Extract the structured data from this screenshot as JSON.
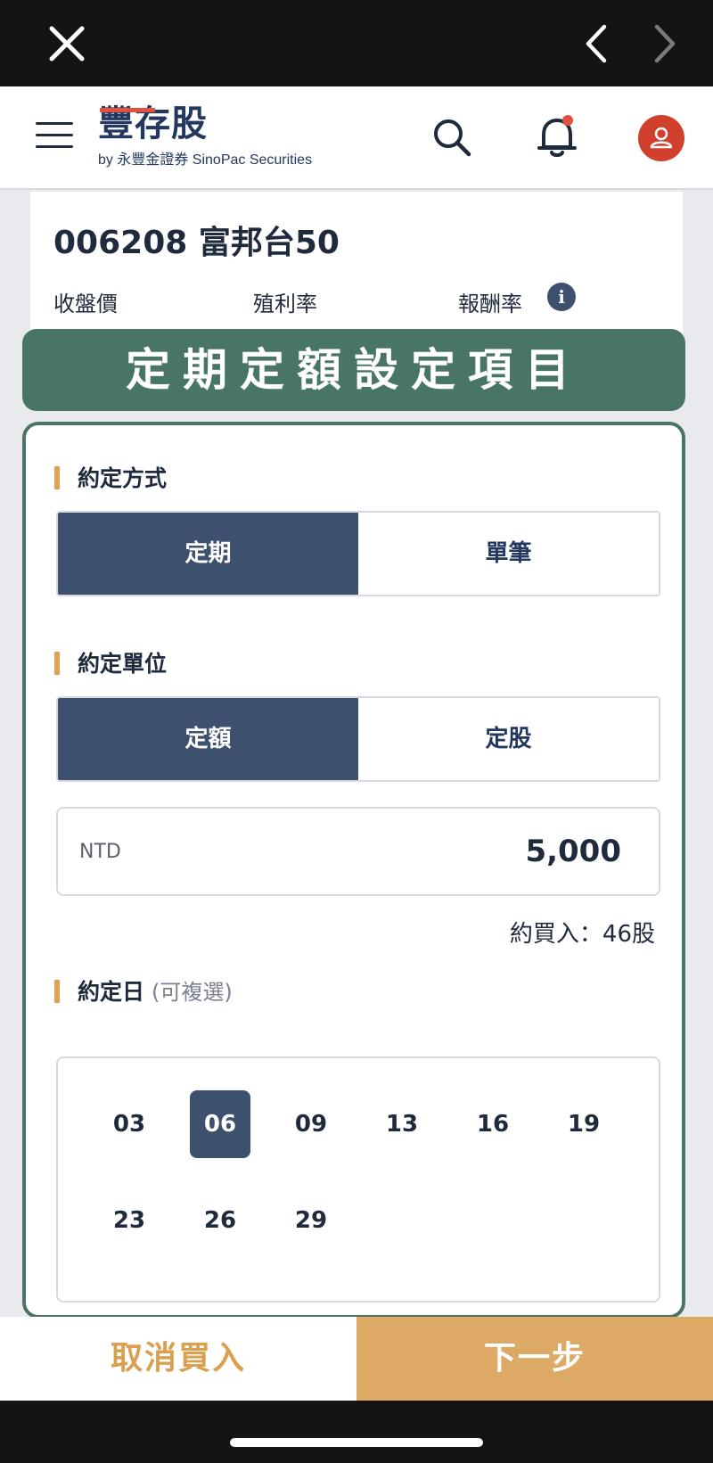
{
  "header": {
    "brand": "豐存股",
    "brand_sub": "by 永豐金證券 SinoPac Securities"
  },
  "stock": {
    "title": "006208 富邦台50",
    "stats": [
      "收盤價",
      "殖利率",
      "報酬率"
    ],
    "info_symbol": "i"
  },
  "banner": {
    "text": "定期定額設定項目"
  },
  "method": {
    "label": "約定方式",
    "options": [
      "定期",
      "單筆"
    ],
    "selected": "定期"
  },
  "unit": {
    "label": "約定單位",
    "options": [
      "定額",
      "定股"
    ],
    "selected": "定額"
  },
  "amount": {
    "currency": "NTD",
    "value": "5,000",
    "approx": "約買入：46股"
  },
  "days": {
    "label": "約定日",
    "hint": "(可複選)",
    "options": [
      "03",
      "06",
      "09",
      "13",
      "16",
      "19",
      "23",
      "26",
      "29"
    ],
    "selected": [
      "06"
    ]
  },
  "footer": {
    "cancel": "取消買入",
    "next": "下一步"
  },
  "colors": {
    "navy": "#3d506d",
    "green": "#487566",
    "gold": "#ddaa66",
    "red": "#d0402d"
  }
}
